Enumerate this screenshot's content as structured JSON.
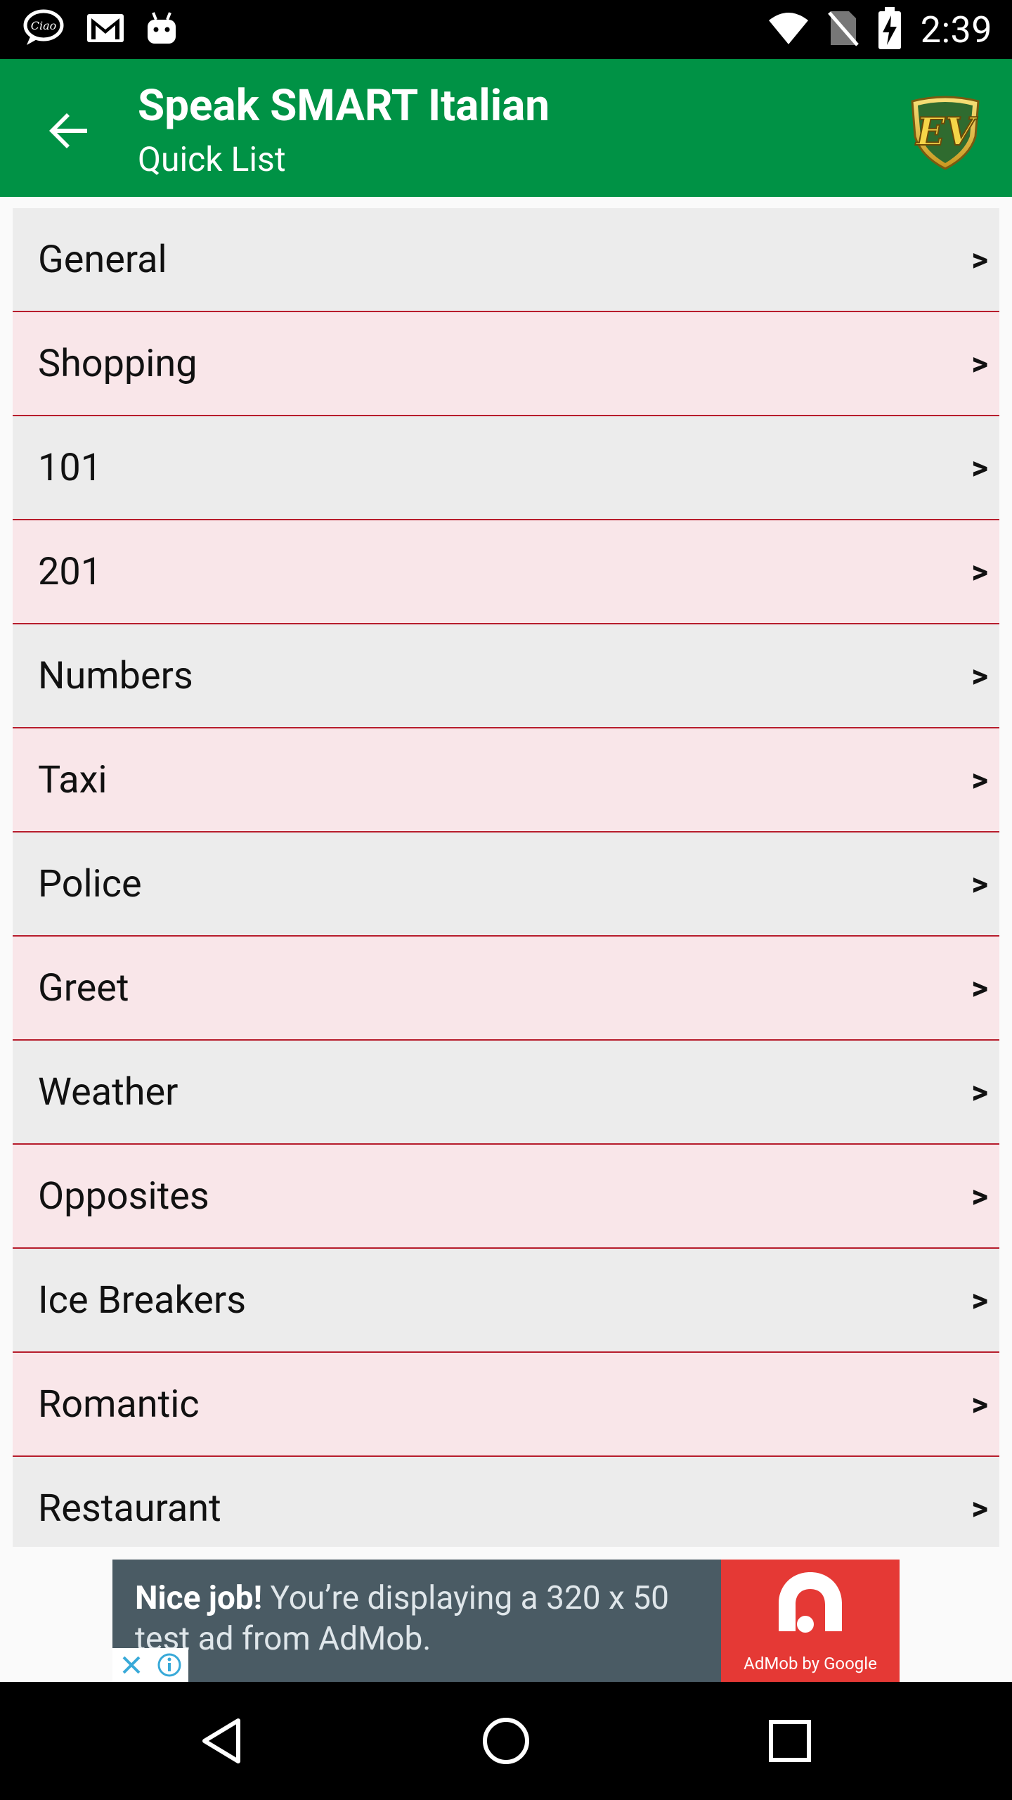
{
  "status_bar": {
    "time": "2:39",
    "left_icons": [
      "ciao-app-icon",
      "gmail-icon",
      "android-icon"
    ],
    "right_icons": [
      "wifi-icon",
      "no-sim-icon",
      "battery-charging-icon"
    ]
  },
  "app_bar": {
    "title": "Speak SMART Italian",
    "subtitle": "Quick List",
    "logo_text": "EV",
    "color": "#009245"
  },
  "list": {
    "chevron": ">",
    "items": [
      {
        "label": "General"
      },
      {
        "label": "Shopping"
      },
      {
        "label": "101"
      },
      {
        "label": "201"
      },
      {
        "label": "Numbers"
      },
      {
        "label": "Taxi"
      },
      {
        "label": "Police"
      },
      {
        "label": "Greet"
      },
      {
        "label": "Weather"
      },
      {
        "label": "Opposites"
      },
      {
        "label": "Ice Breakers"
      },
      {
        "label": "Romantic"
      },
      {
        "label": "Restaurant"
      }
    ],
    "row_colors": {
      "odd": "#ececec",
      "even": "#f9e6e9",
      "divider": "#b71c2c"
    }
  },
  "ad": {
    "headline": "Nice job!",
    "body": " You’re displaying a 320 x 50 test ad from AdMob.",
    "brand": "AdMob by Google"
  },
  "nav_bar": {
    "buttons": [
      "back-icon",
      "home-icon",
      "recents-icon"
    ]
  }
}
